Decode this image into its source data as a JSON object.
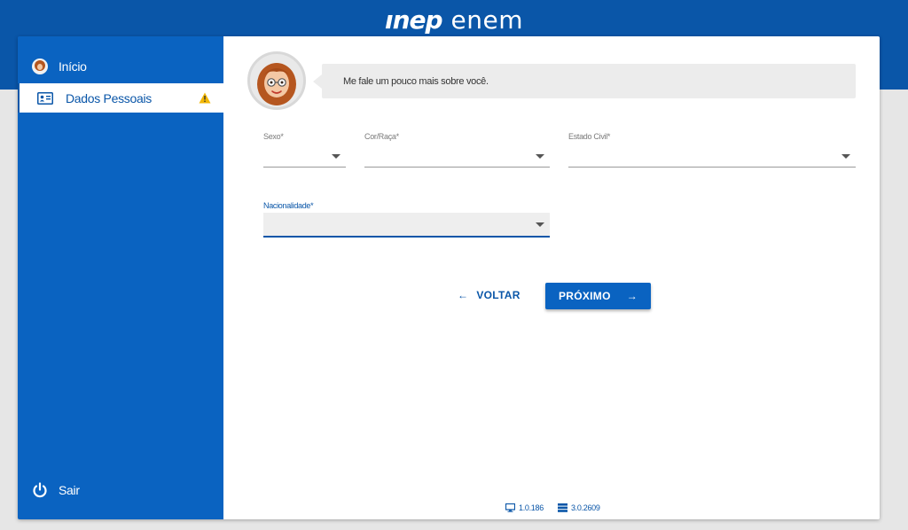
{
  "header": {
    "logo_inep": "ınep",
    "logo_enem": "enem"
  },
  "sidebar": {
    "items": [
      {
        "label": "Início",
        "icon": "avatar-icon"
      },
      {
        "label": "Dados Pessoais",
        "icon": "id-card-icon",
        "status_icon": "warning-icon"
      }
    ],
    "logout_label": "Sair"
  },
  "assistant": {
    "message": "Me fale um pouco mais sobre você."
  },
  "form": {
    "sexo": {
      "label": "Sexo*",
      "value": ""
    },
    "cor_raca": {
      "label": "Cor/Raça*",
      "value": ""
    },
    "estado_civil": {
      "label": "Estado Civil*",
      "value": ""
    },
    "nacionalidade": {
      "label": "Nacionalidade*",
      "value": ""
    }
  },
  "actions": {
    "back_label": "VOLTAR",
    "next_label": "PRÓXIMO"
  },
  "footer": {
    "client_version": "1.0.186",
    "server_version": "3.0.2609"
  },
  "colors": {
    "brand_blue": "#0a56a8",
    "sidebar_blue": "#0a63c1",
    "warning": "#f2b705"
  }
}
